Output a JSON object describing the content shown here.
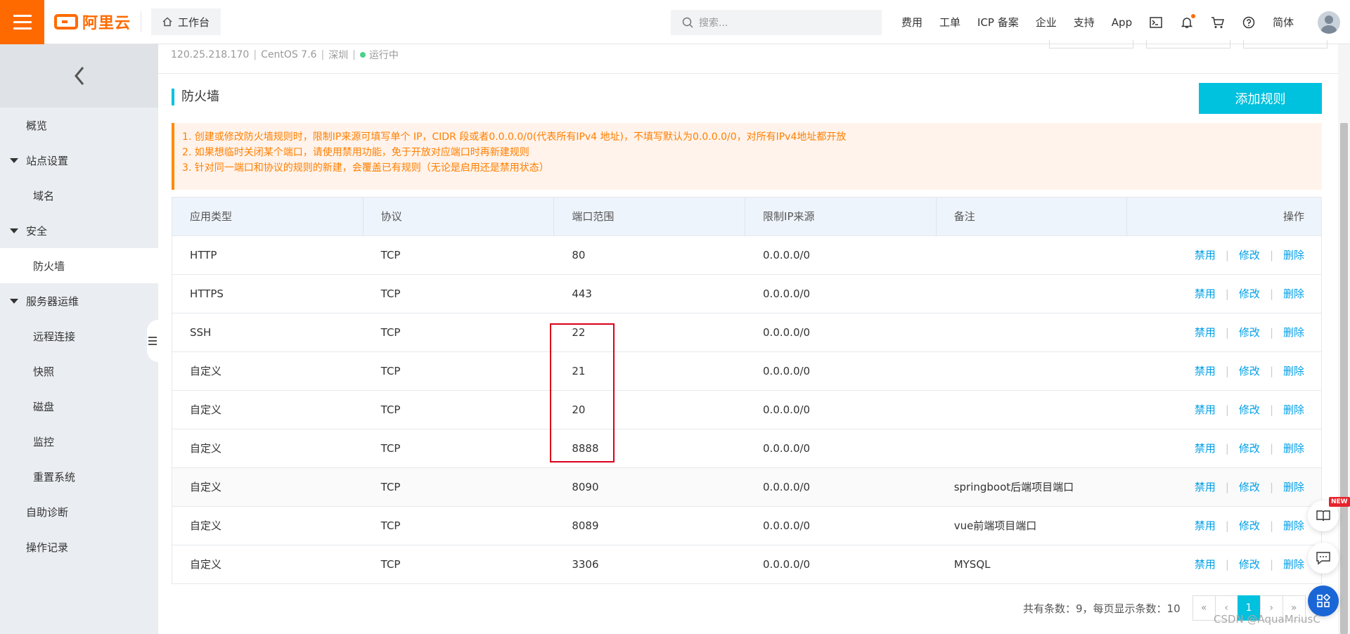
{
  "topbar": {
    "brand": "阿里云",
    "workbench": "工作台",
    "search_placeholder": "搜索...",
    "links": [
      "费用",
      "工单",
      "ICP 备案",
      "企业",
      "支持",
      "App"
    ],
    "lang": "简体",
    "icons": [
      "terminal-icon",
      "bell-icon",
      "cart-icon",
      "help-icon"
    ]
  },
  "sidebar": {
    "items": [
      {
        "label": "概览",
        "level": 1
      },
      {
        "label": "站点设置",
        "level": 1,
        "group": true
      },
      {
        "label": "域名",
        "level": 2
      },
      {
        "label": "安全",
        "level": 1,
        "group": true
      },
      {
        "label": "防火墙",
        "level": 2,
        "active": true
      },
      {
        "label": "服务器运维",
        "level": 1,
        "group": true
      },
      {
        "label": "远程连接",
        "level": 2
      },
      {
        "label": "快照",
        "level": 2
      },
      {
        "label": "磁盘",
        "level": 2
      },
      {
        "label": "监控",
        "level": 2
      },
      {
        "label": "重置系统",
        "level": 2
      },
      {
        "label": "自助诊断",
        "level": 1
      },
      {
        "label": "操作记录",
        "level": 1
      }
    ]
  },
  "server": {
    "ip": "120.25.218.170",
    "os": "CentOS 7.6",
    "region": "深圳",
    "status": "运行中"
  },
  "section": {
    "title": "防火墙",
    "add_button": "添加规则"
  },
  "notice": [
    "1. 创建或修改防火墙规则时，限制IP来源可填写单个 IP，CIDR 段或者0.0.0.0/0(代表所有IPv4 地址)，不填写默认为0.0.0.0/0，对所有IPv4地址都开放",
    "2. 如果想临时关闭某个端口，请使用禁用功能，免于开放对应端口时再新建规则",
    "3. 针对同一端口和协议的规则的新建，会覆盖已有规则（无论是启用还是禁用状态）"
  ],
  "table": {
    "headers": [
      "应用类型",
      "协议",
      "端口范围",
      "限制IP来源",
      "备注",
      "操作"
    ],
    "actions": [
      "禁用",
      "修改",
      "删除"
    ],
    "rows": [
      {
        "type": "HTTP",
        "protocol": "TCP",
        "port": "80",
        "source": "0.0.0.0/0",
        "note": ""
      },
      {
        "type": "HTTPS",
        "protocol": "TCP",
        "port": "443",
        "source": "0.0.0.0/0",
        "note": ""
      },
      {
        "type": "SSH",
        "protocol": "TCP",
        "port": "22",
        "source": "0.0.0.0/0",
        "note": ""
      },
      {
        "type": "自定义",
        "protocol": "TCP",
        "port": "21",
        "source": "0.0.0.0/0",
        "note": ""
      },
      {
        "type": "自定义",
        "protocol": "TCP",
        "port": "20",
        "source": "0.0.0.0/0",
        "note": ""
      },
      {
        "type": "自定义",
        "protocol": "TCP",
        "port": "8888",
        "source": "0.0.0.0/0",
        "note": ""
      },
      {
        "type": "自定义",
        "protocol": "TCP",
        "port": "8090",
        "source": "0.0.0.0/0",
        "note": "springboot后端项目端口"
      },
      {
        "type": "自定义",
        "protocol": "TCP",
        "port": "8089",
        "source": "0.0.0.0/0",
        "note": "vue前端项目端口"
      },
      {
        "type": "自定义",
        "protocol": "TCP",
        "port": "3306",
        "source": "0.0.0.0/0",
        "note": "MYSQL"
      }
    ]
  },
  "pagination": {
    "info": "共有条数：9，每页显示条数：10",
    "first": "«",
    "prev": "‹",
    "current": "1",
    "next": "›",
    "last": "»"
  },
  "floating": {
    "new_badge": "NEW"
  },
  "watermark": "CSDN @AquaMriusC",
  "colors": {
    "brand": "#ff6a00",
    "accent": "#00c1de",
    "link": "#00a0e9",
    "highlight": "#d9001b"
  }
}
